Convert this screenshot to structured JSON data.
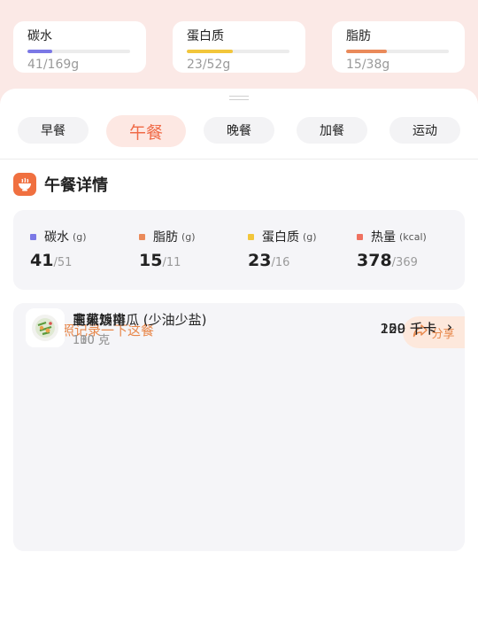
{
  "macros_top": [
    {
      "name": "碳水",
      "value": "41/169g",
      "progress": 0.24,
      "color": "#7b78e6"
    },
    {
      "name": "蛋白质",
      "value": "23/52g",
      "progress": 0.44,
      "color": "#f2c63b"
    },
    {
      "name": "脂肪",
      "value": "15/38g",
      "progress": 0.39,
      "color": "#ea8a5a"
    }
  ],
  "tabs": [
    {
      "label": "早餐",
      "active": false
    },
    {
      "label": "午餐",
      "active": true
    },
    {
      "label": "晚餐",
      "active": false
    },
    {
      "label": "加餐",
      "active": false
    },
    {
      "label": "运动",
      "active": false
    }
  ],
  "section": {
    "title": "午餐详情"
  },
  "summary": [
    {
      "label": "碳水",
      "unit": "(g)",
      "current": "41",
      "target": "/51",
      "color": "#7b78e6"
    },
    {
      "label": "脂肪",
      "unit": "(g)",
      "current": "15",
      "target": "/11",
      "color": "#ea8a5a"
    },
    {
      "label": "蛋白质",
      "unit": "(g)",
      "current": "23",
      "target": "/16",
      "color": "#f2c63b"
    },
    {
      "label": "热量",
      "unit": "(kcal)",
      "current": "378",
      "target": "/369",
      "color": "#ef7160"
    }
  ],
  "meal": {
    "photo_prompt": "拍照记录一下这餐",
    "share_label": "分享",
    "foods": [
      {
        "name": "玉米饭",
        "amount": "100 克",
        "calories": "100 千卡"
      },
      {
        "name": "南煎鸡排",
        "amount": "110 克",
        "calories": "220 千卡"
      },
      {
        "name": "韭菜炒南瓜 (少油少盐)",
        "amount": "130 克",
        "calories": "59 千卡"
      }
    ]
  },
  "colors": {
    "accent": "#f06a47",
    "link": "#e8874a"
  }
}
